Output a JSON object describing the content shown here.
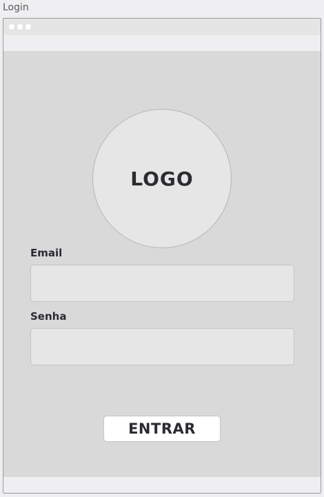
{
  "page": {
    "label": "Login"
  },
  "window": {
    "titlebar_dots": [
      "dot",
      "dot",
      "dot"
    ]
  },
  "logo": {
    "text": "LOGO"
  },
  "form": {
    "email_label": "Email",
    "email_value": "",
    "password_label": "Senha",
    "password_value": ""
  },
  "actions": {
    "submit_label": "ENTRAR"
  },
  "colors": {
    "background": "#d9d9d9",
    "bars": "#efeff1",
    "input_fill": "#e6e6e6",
    "text": "#2b2b30",
    "button_fill": "#ffffff"
  }
}
